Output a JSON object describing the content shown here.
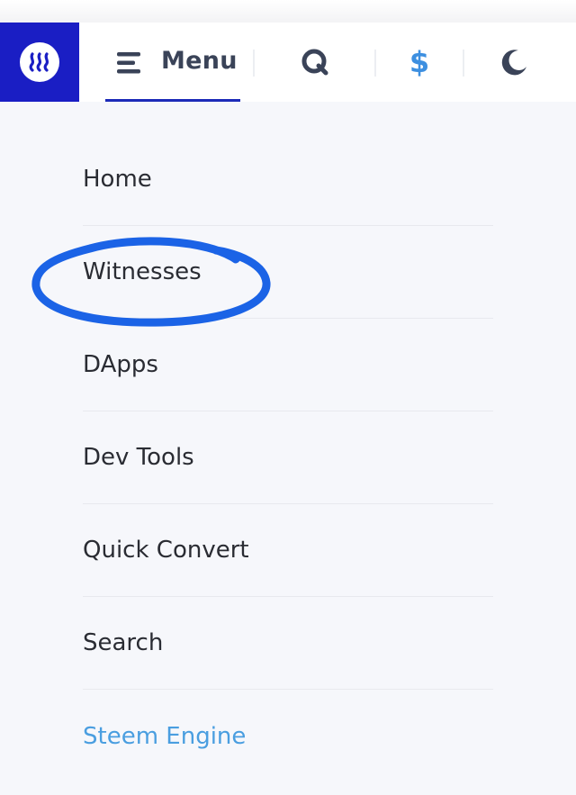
{
  "header": {
    "menu_label": "Menu",
    "currency_symbol": "$",
    "icons": [
      "steem-logo-icon",
      "hamburger-icon",
      "search-icon",
      "dollar-icon",
      "moon-icon"
    ]
  },
  "nav": {
    "items": [
      {
        "label": "Home"
      },
      {
        "label": "Witnesses"
      },
      {
        "label": "DApps"
      },
      {
        "label": "Dev Tools"
      },
      {
        "label": "Quick Convert"
      },
      {
        "label": "Search"
      },
      {
        "label": "Steem Engine"
      }
    ]
  },
  "colors": {
    "brand_blue": "#1a1ec4",
    "menu_underline": "#1c2bb8",
    "dollar_blue": "#3d8fe0",
    "accent_link": "#4a9ee0",
    "annotation_blue": "#1b63e6",
    "background": "#f6f7fb"
  }
}
